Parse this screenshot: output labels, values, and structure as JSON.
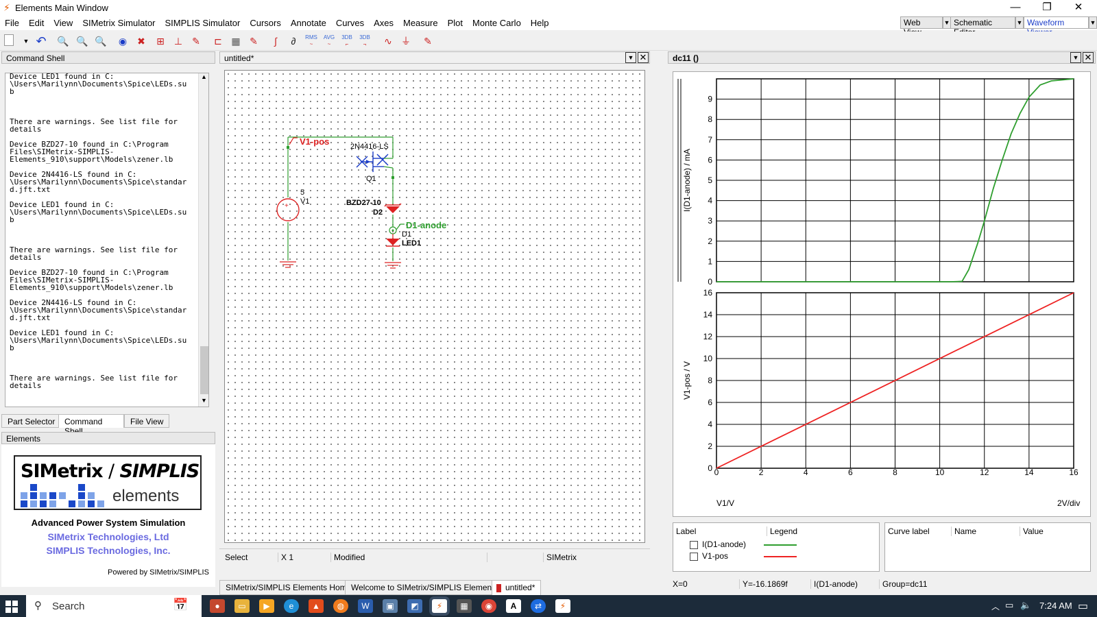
{
  "window": {
    "title": "Elements Main Window"
  },
  "menu": [
    "File",
    "Edit",
    "View",
    "SIMetrix Simulator",
    "SIMPLIS Simulator",
    "Cursors",
    "Annotate",
    "Curves",
    "Axes",
    "Measure",
    "Plot",
    "Monte Carlo",
    "Help"
  ],
  "view_buttons": {
    "web": "Web View",
    "schematic": "Schematic Editor",
    "waveform": "Waveform Viewer"
  },
  "toolbar_labels": {
    "rms": "RMS",
    "avg": "AVG",
    "db1": "3DB",
    "db2": "3DB"
  },
  "command_shell": {
    "title": "Command Shell",
    "text": "Device LED1 found in C:\n\\Users\\Marilynn\\Documents\\Spice\\LEDs.su\nb\n\n\n\nThere are warnings. See list file for\ndetails\n\nDevice BZD27-10 found in C:\\Program\nFiles\\SIMetrix-SIMPLIS-\nElements_910\\support\\Models\\zener.lb\n\nDevice 2N4416-LS found in C:\n\\Users\\Marilynn\\Documents\\Spice\\standar\nd.jft.txt\n\nDevice LED1 found in C:\n\\Users\\Marilynn\\Documents\\Spice\\LEDs.su\nb\n\n\n\nThere are warnings. See list file for\ndetails\n\nDevice BZD27-10 found in C:\\Program\nFiles\\SIMetrix-SIMPLIS-\nElements_910\\support\\Models\\zener.lb\n\nDevice 2N4416-LS found in C:\n\\Users\\Marilynn\\Documents\\Spice\\standar\nd.jft.txt\n\nDevice LED1 found in C:\n\\Users\\Marilynn\\Documents\\Spice\\LEDs.su\nb\n\n\n\nThere are warnings. See list file for\ndetails"
  },
  "left_tabs": [
    "Part Selector",
    "Command Shell",
    "File View"
  ],
  "elements_panel": {
    "title": "Elements",
    "logo_left": "SIMetrix",
    "logo_slash": "/",
    "logo_right": "SIMPLIS",
    "logo_sub": "elements",
    "tagline": "Advanced Power System Simulation",
    "company1": "SIMetrix Technologies, Ltd",
    "company2": "SIMPLIS Technologies, Inc.",
    "powered": "Powered by SIMetrix/SIMPLIS"
  },
  "schematic": {
    "title": "untitled*",
    "labels": {
      "v1pos": "V1-pos",
      "q_model": "2N4416-LS",
      "q_name": "Q1",
      "v_value": "5",
      "v_name": "V1",
      "zener_model": "BZD27-10",
      "zener_name": "D2",
      "d1anode": "D1-anode",
      "d1": "D1",
      "led": "LED1"
    },
    "status": [
      "Select",
      "X 1",
      "Modified",
      "",
      "SIMetrix"
    ],
    "bottom_tabs": [
      "SIMetrix/SIMPLIS Elements Home",
      "Welcome to SIMetrix/SIMPLIS Elements",
      "untitled*"
    ]
  },
  "graph": {
    "title": "dc11 ()",
    "xlabel_left": "V1/V",
    "xlabel_right": "2V/div",
    "legend": {
      "headers": [
        "Label",
        "Legend"
      ],
      "items": [
        {
          "label": "I(D1-anode)",
          "color": "#2e9e2e"
        },
        {
          "label": "V1-pos",
          "color": "#ee2222"
        }
      ]
    },
    "curve_headers": [
      "Curve label",
      "Name",
      "Value"
    ],
    "status": [
      "X=0",
      "Y=-16.1869f",
      "I(D1-anode)",
      "Group=dc11"
    ]
  },
  "chart_data": [
    {
      "type": "line",
      "title": "",
      "ylabel": "I(D1-anode) / mA",
      "xlabel": "V1/V",
      "xlim": [
        0,
        16
      ],
      "ylim": [
        0,
        10
      ],
      "yticks": [
        0,
        1,
        2,
        3,
        4,
        5,
        6,
        7,
        8,
        9
      ],
      "xticks": [
        0,
        2,
        4,
        6,
        8,
        10,
        12,
        14,
        16
      ],
      "grid": true,
      "series": [
        {
          "name": "I(D1-anode)",
          "color": "#2e9e2e",
          "x": [
            0,
            10.5,
            11.0,
            11.3,
            11.7,
            12.0,
            12.4,
            12.8,
            13.2,
            13.6,
            14.0,
            14.5,
            15.0,
            16.0
          ],
          "y": [
            0,
            0,
            0.02,
            0.6,
            1.9,
            3.0,
            4.6,
            6.0,
            7.3,
            8.3,
            9.1,
            9.7,
            9.9,
            10.0
          ]
        }
      ]
    },
    {
      "type": "line",
      "title": "",
      "ylabel": "V1-pos / V",
      "xlabel": "V1/V",
      "xlim": [
        0,
        16
      ],
      "ylim": [
        0,
        16
      ],
      "yticks": [
        0,
        2,
        4,
        6,
        8,
        10,
        12,
        14,
        16
      ],
      "xticks": [
        0,
        2,
        4,
        6,
        8,
        10,
        12,
        14,
        16
      ],
      "grid": true,
      "series": [
        {
          "name": "V1-pos",
          "color": "#ee2222",
          "x": [
            0,
            16
          ],
          "y": [
            0,
            16
          ]
        }
      ]
    }
  ],
  "taskbar": {
    "search": "Search",
    "time": "7:24 AM"
  }
}
